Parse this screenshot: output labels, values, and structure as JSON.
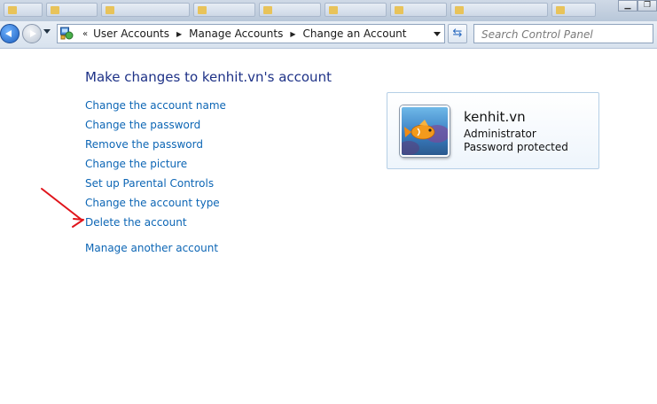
{
  "window": {
    "minimize_glyph": "▁",
    "restore_glyph": "❐"
  },
  "address_bar": {
    "overflow_glyph": "«",
    "breadcrumb": [
      "User Accounts",
      "Manage Accounts",
      "Change an Account"
    ],
    "refresh_glyph": "⇆"
  },
  "search": {
    "placeholder": "Search Control Panel"
  },
  "main": {
    "heading": "Make changes to kenhit.vn's account",
    "tasks": [
      "Change the account name",
      "Change the password",
      "Remove the password",
      "Change the picture",
      "Set up Parental Controls",
      "Change the account type",
      "Delete the account"
    ],
    "other_task": "Manage another account"
  },
  "account_card": {
    "name": "kenhit.vn",
    "role": "Administrator",
    "status": "Password protected"
  },
  "annotation": {
    "arrow_color": "#e0141b"
  },
  "icons": {
    "back": "back-arrow-icon",
    "forward": "forward-arrow-icon",
    "control_panel": "control-panel-icon",
    "refresh": "refresh-icon",
    "avatar": "fish-picture"
  }
}
